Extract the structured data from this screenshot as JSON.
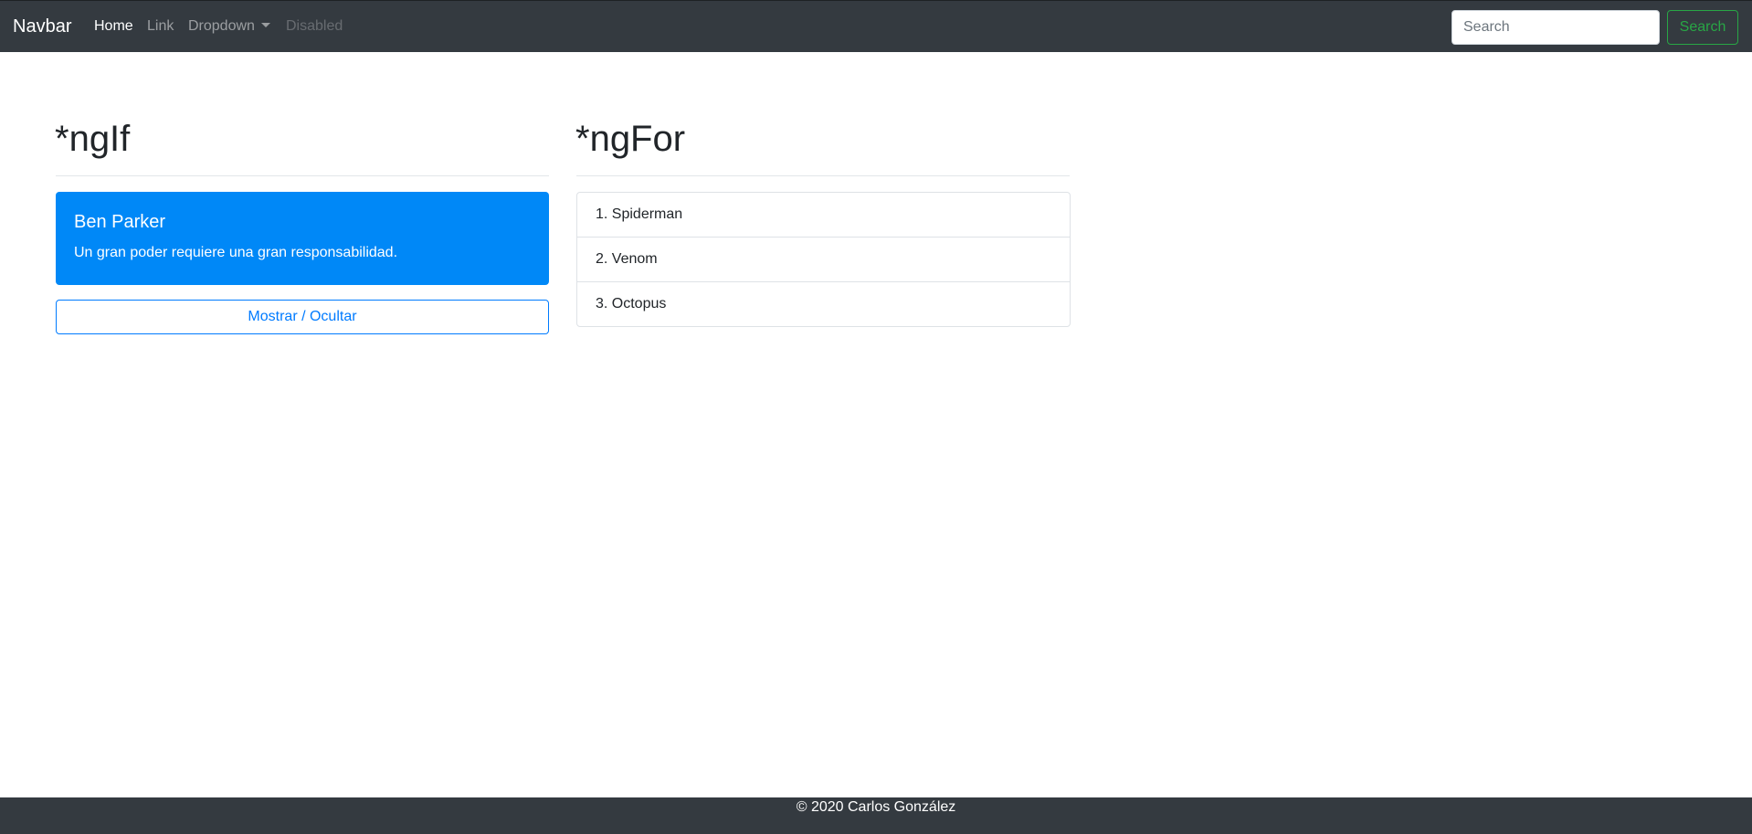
{
  "navbar": {
    "brand": "Navbar",
    "links": [
      {
        "label": "Home"
      },
      {
        "label": "Link"
      },
      {
        "label": "Dropdown"
      },
      {
        "label": "Disabled"
      }
    ],
    "search_placeholder": "Search",
    "search_button": "Search"
  },
  "ngif": {
    "title": "*ngIf",
    "card": {
      "title": "Ben Parker",
      "text": "Un gran poder requiere una gran responsabilidad."
    },
    "toggle_button": "Mostrar / Ocultar"
  },
  "ngfor": {
    "title": "*ngFor",
    "items": [
      "1. Spiderman",
      "2. Venom",
      "3. Octopus"
    ]
  },
  "footer": {
    "text": "© 2020 Carlos González"
  },
  "colors": {
    "navbar_bg": "#343a40",
    "primary": "#007bff",
    "card_bg": "#0088f7",
    "success": "#28a745"
  }
}
